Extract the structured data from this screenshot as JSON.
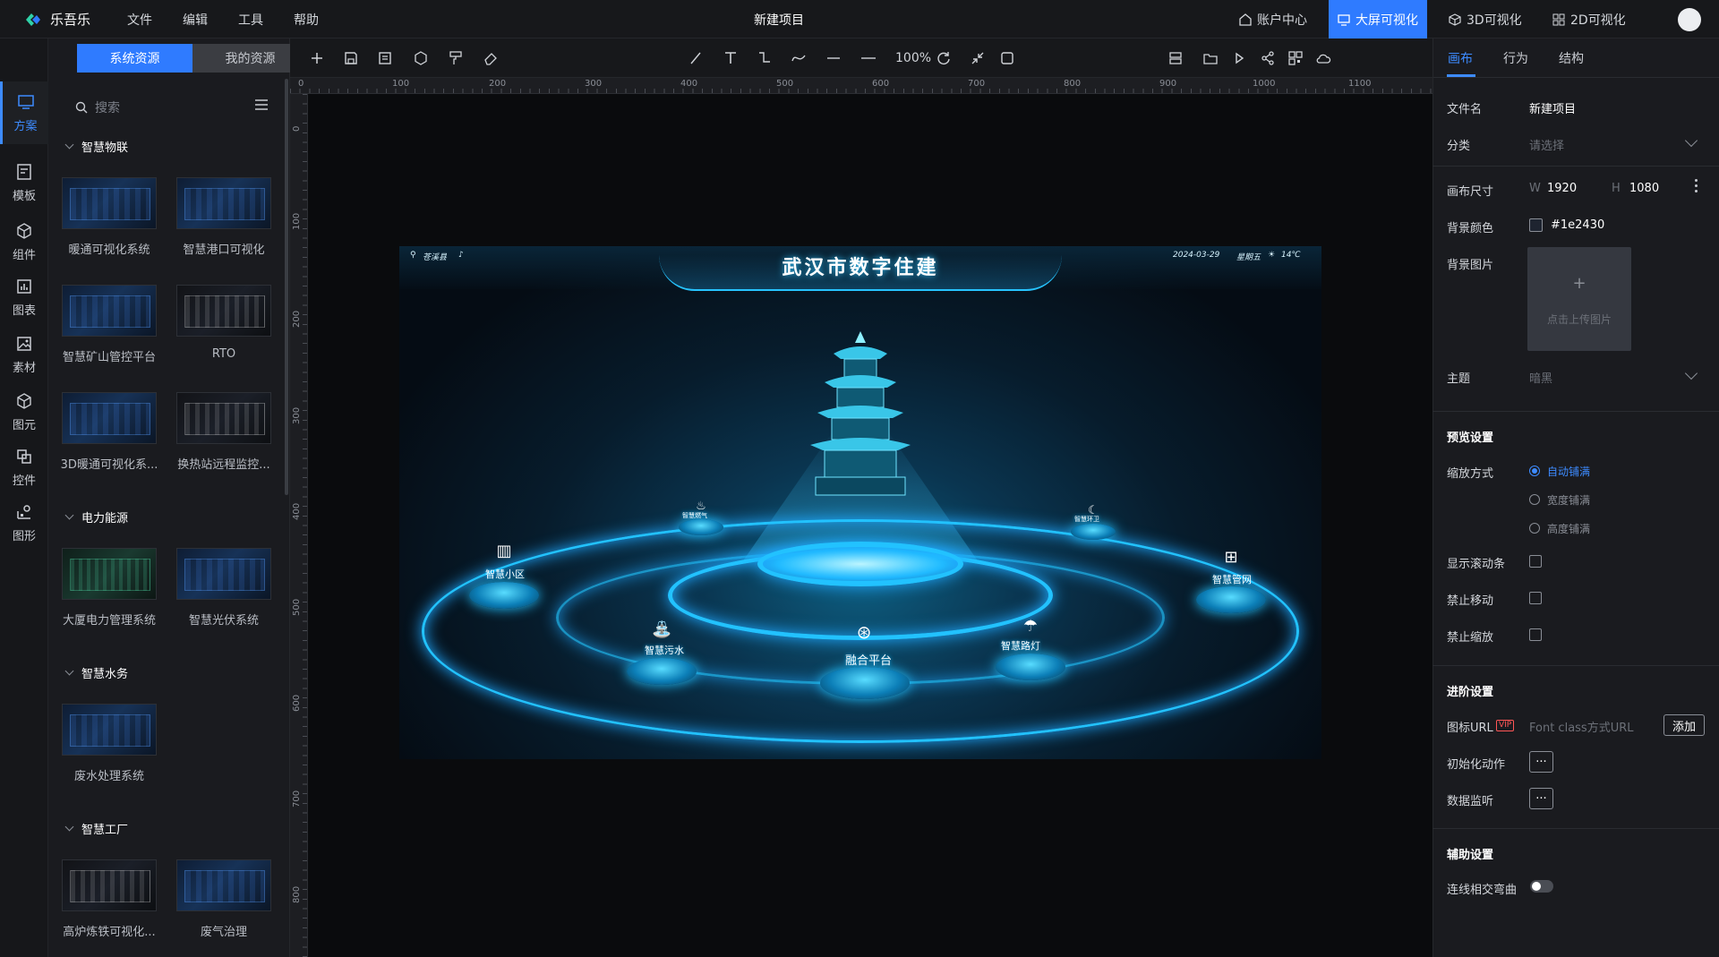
{
  "app": {
    "name": "乐吾乐",
    "document_title": "新建项目",
    "menu": [
      "文件",
      "编辑",
      "工具",
      "帮助"
    ],
    "top_links": [
      {
        "label": "账户中心",
        "icon": "home-icon",
        "active": false
      },
      {
        "label": "大屏可视化",
        "icon": "monitor-icon",
        "active": true
      },
      {
        "label": "3D可视化",
        "icon": "cube-icon",
        "active": false
      },
      {
        "label": "2D可视化",
        "icon": "grid-icon",
        "active": false
      }
    ],
    "accent_color": "#2f7bff"
  },
  "rail": {
    "items": [
      {
        "label": "方案",
        "icon": "monitor-icon",
        "active": true
      },
      {
        "label": "模板",
        "icon": "template-icon",
        "active": false
      },
      {
        "label": "组件",
        "icon": "component-icon",
        "active": false
      },
      {
        "label": "图表",
        "icon": "chart-icon",
        "active": false
      },
      {
        "label": "素材",
        "icon": "image-icon",
        "active": false
      },
      {
        "label": "图元",
        "icon": "cube-icon",
        "active": false
      },
      {
        "label": "控件",
        "icon": "widget-icon",
        "active": false
      },
      {
        "label": "图形",
        "icon": "shape-icon",
        "active": false
      }
    ]
  },
  "resources": {
    "tabs": [
      "系统资源",
      "我的资源"
    ],
    "active_tab": "系统资源",
    "search_placeholder": "搜索",
    "groups": [
      {
        "title": "智慧物联",
        "items": [
          "暖通可视化系统",
          "智慧港口可视化",
          "智慧矿山管控平台",
          "RTO",
          "3D暖通可视化系...",
          "换热站远程监控..."
        ]
      },
      {
        "title": "电力能源",
        "items": [
          "大厦电力管理系统",
          "智慧光伏系统"
        ]
      },
      {
        "title": "智慧水务",
        "items": [
          "废水处理系统"
        ]
      },
      {
        "title": "智慧工厂",
        "items": [
          "高炉炼铁可视化...",
          "废气治理"
        ]
      }
    ]
  },
  "toolbar": {
    "zoom": "100%",
    "left_icons": [
      "add-icon",
      "save-icon",
      "file-icon",
      "shape-icon",
      "format-painter-icon",
      "eraser-icon"
    ],
    "draw_icons": [
      "line-icon",
      "text-icon",
      "polyline-icon",
      "curve-icon",
      "line-solid-icon",
      "line-dash-icon"
    ],
    "view_icons": [
      "refresh-icon",
      "fit-icon",
      "frame-icon"
    ],
    "right_icons": [
      "layers-icon",
      "folder-icon",
      "play-icon",
      "share-icon",
      "qrcode-icon",
      "cloud-icon"
    ]
  },
  "rulers": {
    "horizontal": [
      "0",
      "100",
      "200",
      "300",
      "400",
      "500",
      "600",
      "700",
      "800",
      "900",
      "1000",
      "1100"
    ],
    "vertical": [
      "0",
      "100",
      "200",
      "300",
      "400",
      "500",
      "600",
      "700",
      "800"
    ]
  },
  "preview": {
    "title": "武汉市数字住建",
    "location": "苍溪县",
    "date": "2024-03-29",
    "weekday": "星期五",
    "temperature": "14℃",
    "center_label": "融合平台",
    "nodes": [
      "智慧小区",
      "智慧燃气",
      "智慧污水",
      "智慧环卫",
      "智慧路灯",
      "智慧管网"
    ],
    "glow_color": "#22c2ff"
  },
  "properties": {
    "tabs": [
      "画布",
      "行为",
      "结构"
    ],
    "active_tab": "画布",
    "file_name_label": "文件名",
    "file_name": "新建项目",
    "category_label": "分类",
    "category_placeholder": "请选择",
    "canvas_size_label": "画布尺寸",
    "width_prefix": "W",
    "width": "1920",
    "height_prefix": "H",
    "height": "1080",
    "bg_color_label": "背景颜色",
    "bg_color": "#1e2430",
    "bg_image_label": "背景图片",
    "upload_text": "点击上传图片",
    "theme_label": "主题",
    "theme_value": "暗黑",
    "preview_section": "预览设置",
    "scale_label": "缩放方式",
    "scale_options": [
      "自动铺满",
      "宽度铺满",
      "高度铺满"
    ],
    "scale_selected": "自动铺满",
    "show_scrollbar_label": "显示滚动条",
    "disable_move_label": "禁止移动",
    "disable_zoom_label": "禁止缩放",
    "advanced_section": "进阶设置",
    "icon_url_label": "图标URL",
    "vip_badge": "VIP",
    "icon_url_placeholder": "Font class方式URL",
    "add_button": "添加",
    "init_action_label": "初始化动作",
    "data_monitor_label": "数据监听",
    "more_button": "···",
    "assist_section": "辅助设置",
    "line_cross_label": "连线相交弯曲"
  }
}
